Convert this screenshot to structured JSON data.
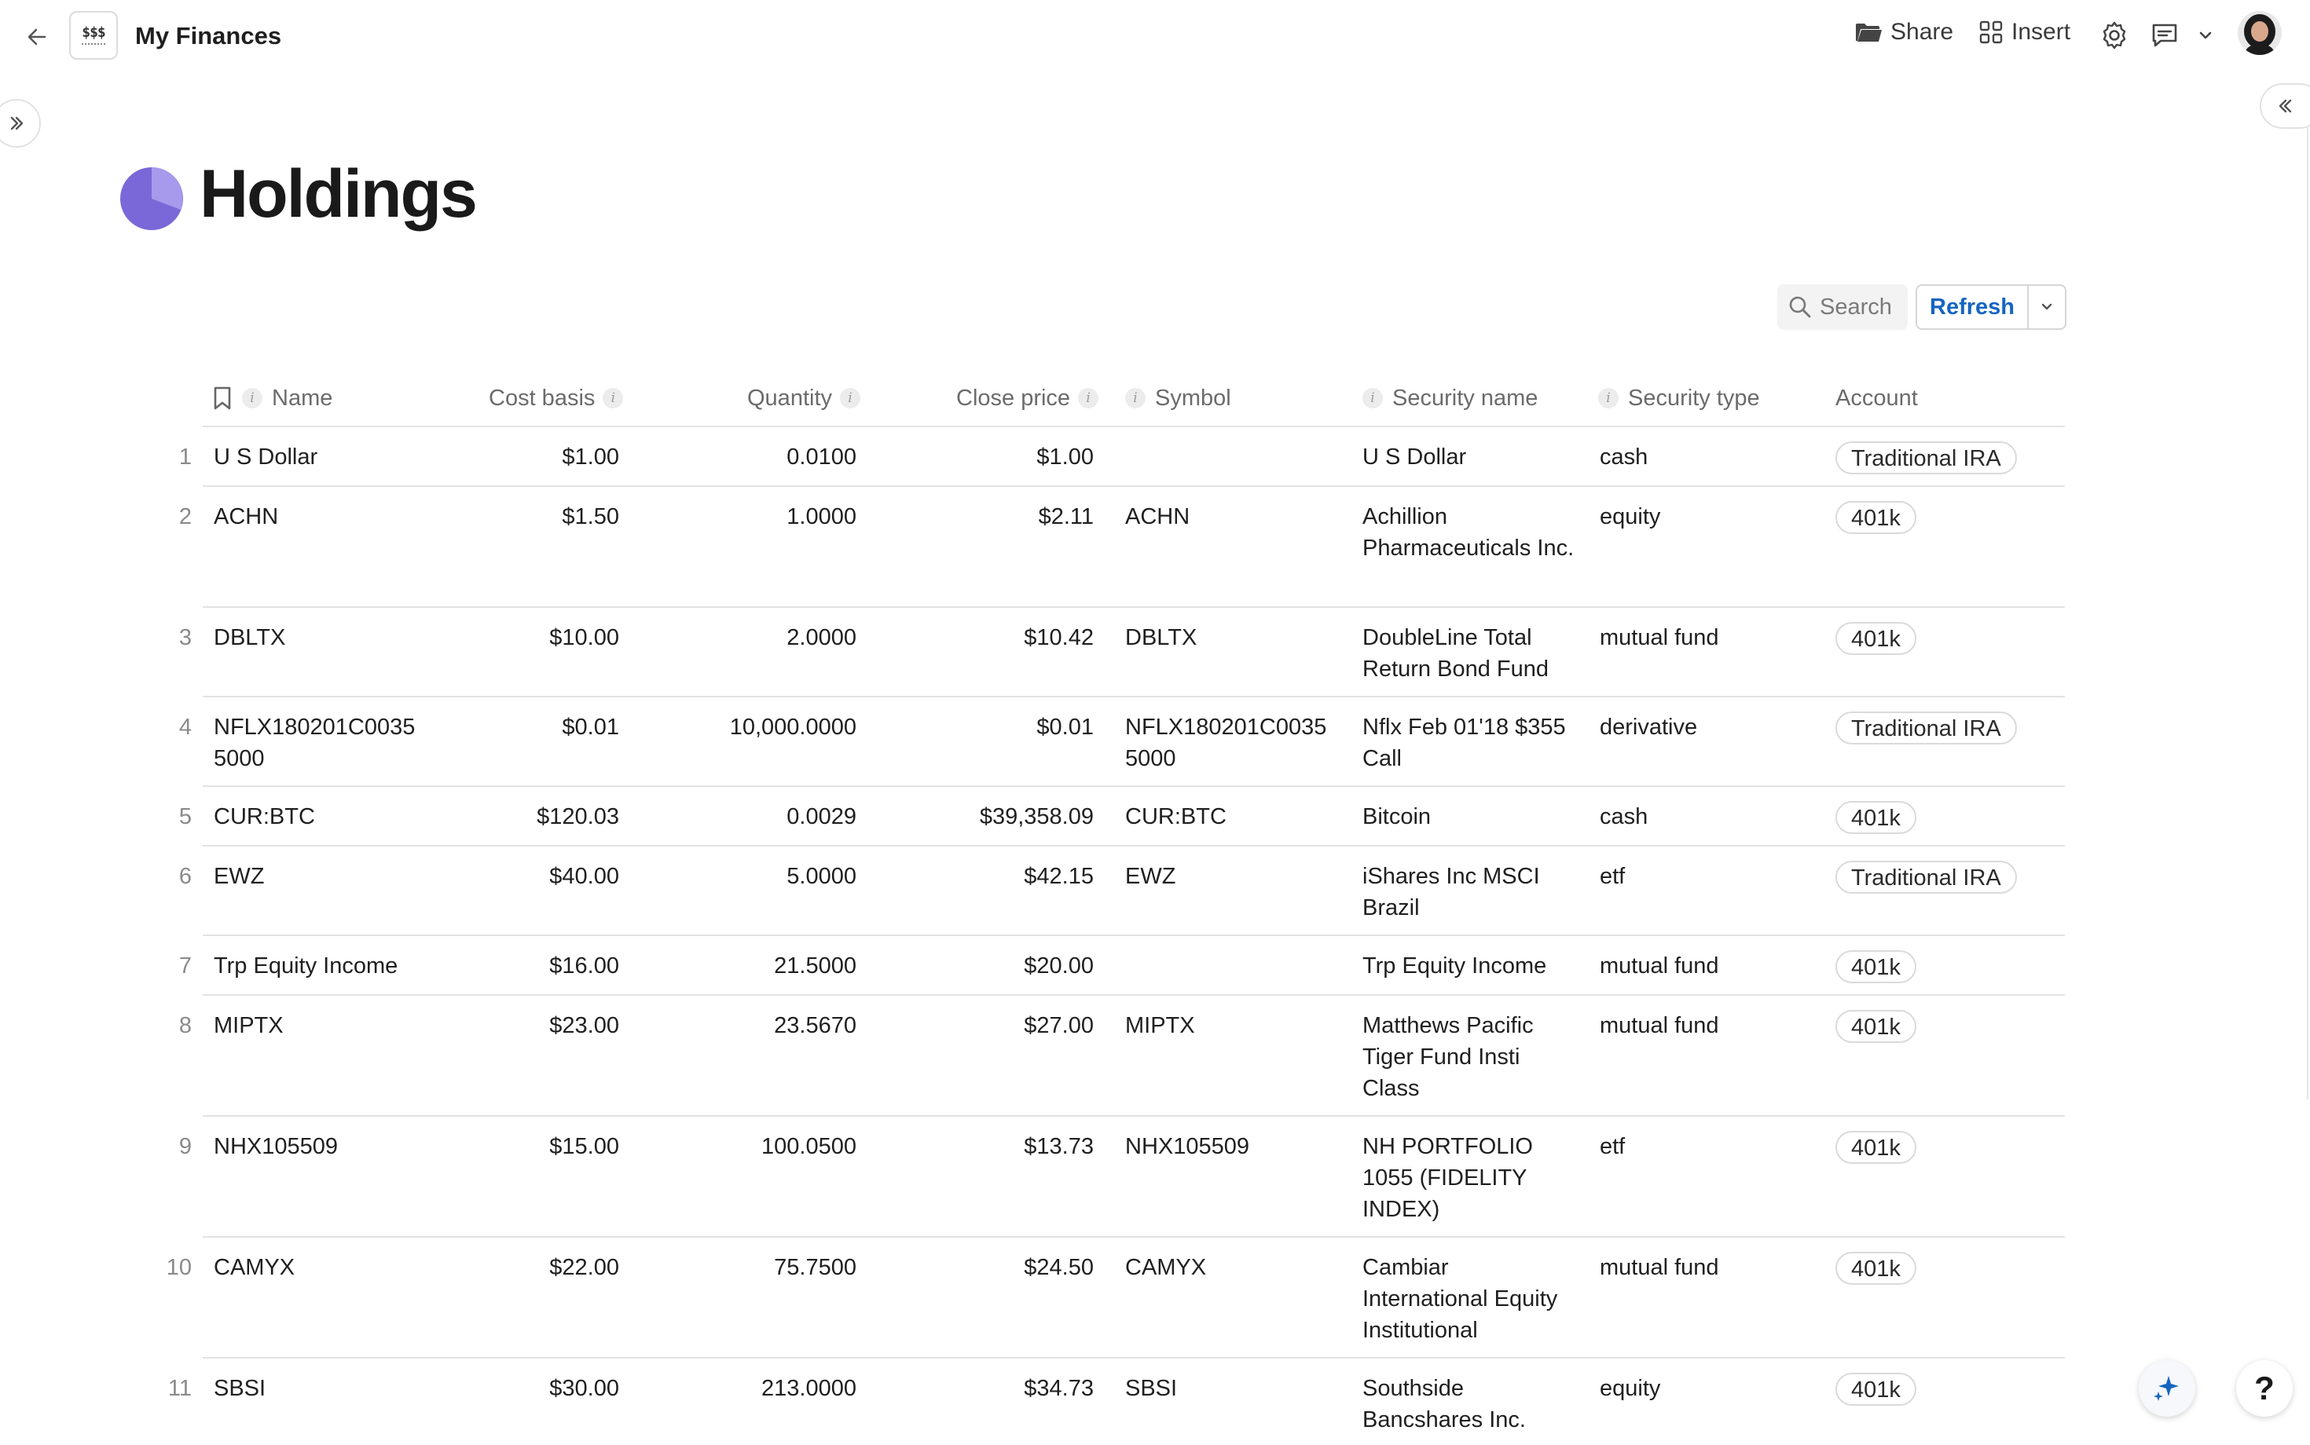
{
  "app": {
    "doc_title": "My Finances",
    "doc_icon_text": "$$$"
  },
  "toolbar": {
    "share_label": "Share",
    "insert_label": "Insert"
  },
  "page": {
    "title": "Holdings"
  },
  "controls": {
    "search_label": "Search",
    "refresh_label": "Refresh"
  },
  "colors": {
    "accent": "#1565c0",
    "page_icon": "#7b68d8",
    "page_icon_light": "#a799ec"
  },
  "table": {
    "columns": [
      "Name",
      "Cost basis",
      "Quantity",
      "Close price",
      "Symbol",
      "Security name",
      "Security type",
      "Account"
    ],
    "rows": [
      {
        "n": "1",
        "name": "U S Dollar",
        "cost": "$1.00",
        "qty": "0.0100",
        "close": "$1.00",
        "symbol": "",
        "secname": "U S Dollar",
        "sectype": "cash",
        "account": "Traditional IRA"
      },
      {
        "n": "2",
        "name": "ACHN",
        "cost": "$1.50",
        "qty": "1.0000",
        "close": "$2.11",
        "symbol": "ACHN",
        "secname": "Achillion Pharmaceuticals Inc.",
        "sectype": "equity",
        "account": "401k"
      },
      {
        "n": "3",
        "name": "DBLTX",
        "cost": "$10.00",
        "qty": "2.0000",
        "close": "$10.42",
        "symbol": "DBLTX",
        "secname": "DoubleLine Total Return Bond Fund",
        "sectype": "mutual fund",
        "account": "401k"
      },
      {
        "n": "4",
        "name": "NFLX180201C00355000",
        "cost": "$0.01",
        "qty": "10,000.0000",
        "close": "$0.01",
        "symbol": "NFLX180201C00355000",
        "secname": "Nflx Feb 01'18 $355 Call",
        "sectype": "derivative",
        "account": "Traditional IRA"
      },
      {
        "n": "5",
        "name": "CUR:BTC",
        "cost": "$120.03",
        "qty": "0.0029",
        "close": "$39,358.09",
        "symbol": "CUR:BTC",
        "secname": "Bitcoin",
        "sectype": "cash",
        "account": "401k"
      },
      {
        "n": "6",
        "name": "EWZ",
        "cost": "$40.00",
        "qty": "5.0000",
        "close": "$42.15",
        "symbol": "EWZ",
        "secname": "iShares Inc MSCI Brazil",
        "sectype": "etf",
        "account": "Traditional IRA"
      },
      {
        "n": "7",
        "name": "Trp Equity Income",
        "cost": "$16.00",
        "qty": "21.5000",
        "close": "$20.00",
        "symbol": "",
        "secname": "Trp Equity Income",
        "sectype": "mutual fund",
        "account": "401k"
      },
      {
        "n": "8",
        "name": "MIPTX",
        "cost": "$23.00",
        "qty": "23.5670",
        "close": "$27.00",
        "symbol": "MIPTX",
        "secname": "Matthews Pacific Tiger Fund Insti Class",
        "sectype": "mutual fund",
        "account": "401k"
      },
      {
        "n": "9",
        "name": "NHX105509",
        "cost": "$15.00",
        "qty": "100.0500",
        "close": "$13.73",
        "symbol": "NHX105509",
        "secname": "NH PORTFOLIO 1055 (FIDELITY INDEX)",
        "sectype": "etf",
        "account": "401k"
      },
      {
        "n": "10",
        "name": "CAMYX",
        "cost": "$22.00",
        "qty": "75.7500",
        "close": "$24.50",
        "symbol": "CAMYX",
        "secname": "Cambiar International Equity Institutional",
        "sectype": "mutual fund",
        "account": "401k"
      },
      {
        "n": "11",
        "name": "SBSI",
        "cost": "$30.00",
        "qty": "213.0000",
        "close": "$34.73",
        "symbol": "SBSI",
        "secname": "Southside Bancshares Inc.",
        "sectype": "equity",
        "account": "401k"
      }
    ]
  }
}
